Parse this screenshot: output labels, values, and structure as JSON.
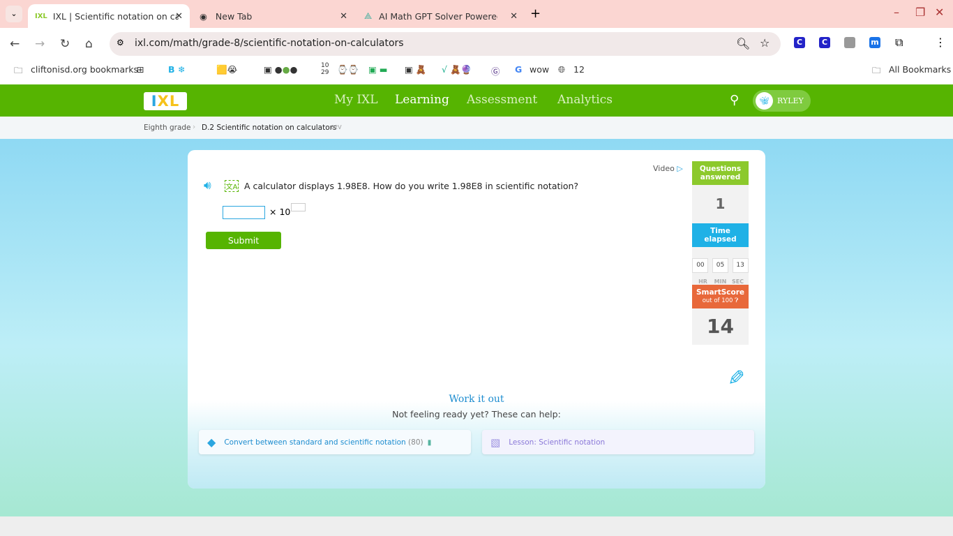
{
  "browser": {
    "tabs": [
      {
        "title": "IXL | Scientific notation on calc",
        "active": true
      },
      {
        "title": "New Tab",
        "active": false
      },
      {
        "title": "AI Math GPT Solver Powered by",
        "active": false
      }
    ],
    "url": "ixl.com/math/grade-8/scientific-notation-on-calculators",
    "bookmarks": {
      "folder": "cliftonisd.org bookmarks",
      "date_top": "10",
      "date_bottom": "29",
      "wow": "wow",
      "count": "12",
      "all": "All Bookmarks"
    }
  },
  "ixl": {
    "nav": [
      "My IXL",
      "Learning",
      "Assessment",
      "Analytics"
    ],
    "active_nav": "Learning",
    "user": "RYLEY",
    "logo": "IXL",
    "breadcrumb": {
      "grade": "Eighth grade",
      "skill": "D.2 Scientific notation on calculators",
      "code": "62V"
    },
    "video": "Video",
    "question": "A calculator displays 1.98E8. How do you write 1.98E8 in scientific notation?",
    "times_ten": "× 10",
    "submit": "Submit",
    "stats": {
      "questions_label": "Questions answered",
      "questions": "1",
      "time_label": "Time elapsed",
      "hr": "00",
      "min": "05",
      "sec": "13",
      "hr_l": "HR",
      "min_l": "MIN",
      "sec_l": "SEC",
      "smartscore_label": "SmartScore",
      "out_of": "out of 100",
      "score": "14"
    },
    "work_it_out": "Work it out",
    "not_ready": "Not feeling ready yet? These can help:",
    "help": [
      {
        "label": "Convert between standard and scientific notation",
        "score": "(80)"
      },
      {
        "label": "Lesson: Scientific notation"
      }
    ],
    "colors": {
      "green": "#56b401",
      "blue": "#1fb1e6",
      "orange": "#e8683a",
      "lime": "#8cc92c"
    }
  }
}
